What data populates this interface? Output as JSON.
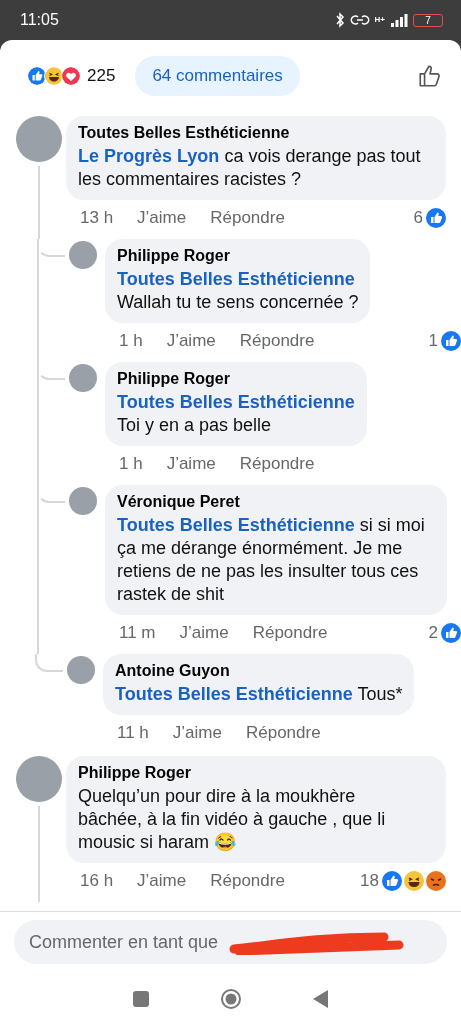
{
  "status_bar": {
    "time": "11:05",
    "network_type": "H+",
    "battery": "7"
  },
  "header": {
    "reactions": [
      {
        "kind": "like"
      },
      {
        "kind": "haha"
      },
      {
        "kind": "love"
      }
    ],
    "reaction_count": "225",
    "comments_button": "64 commentaires"
  },
  "comments": [
    {
      "author": "Toutes Belles Esthéticienne",
      "mention": "Le Progrès Lyon",
      "text": " ca vois derange pas tout les commentaires racistes ?",
      "time": "13 h",
      "like": "J’aime",
      "reply": "Répondre",
      "count": "6",
      "reactions": [
        {
          "kind": "like"
        }
      ],
      "children": [
        {
          "author": "Philippe Roger",
          "mention": "Toutes Belles Esthéticienne",
          "text": "\nWallah tu te sens concernée ?",
          "time": "1 h",
          "like": "J’aime",
          "reply": "Répondre",
          "count": "1",
          "reactions": [
            {
              "kind": "like"
            }
          ]
        },
        {
          "author": "Philippe Roger",
          "mention": "Toutes Belles Esthéticienne",
          "text": "\nToi y en a pas belle",
          "time": "1 h",
          "like": "J’aime",
          "reply": "Répondre"
        },
        {
          "author": "Véronique Peret",
          "mention": "Toutes Belles Esthéticienne",
          "text": " si si moi ça me dérange énormément. Je me retiens de ne pas les insulter tous ces rastek de shit",
          "time": "11 m",
          "like": "J’aime",
          "reply": "Répondre",
          "count": "2",
          "reactions": [
            {
              "kind": "like"
            }
          ]
        },
        {
          "author": "Antoine Guyon",
          "mention": "Toutes Belles Esthéticienne",
          "text": " Tous*",
          "time": "11 h",
          "like": "J’aime",
          "reply": "Répondre"
        }
      ]
    },
    {
      "author": "Philippe Roger",
      "text": "Quelqu’un pour dire à la moukhère\nbâchée, à la fin vidéo à gauche , que li mousic si haram 😂",
      "time": "16 h",
      "like": "J’aime",
      "reply": "Répondre",
      "count": "18",
      "reactions": [
        {
          "kind": "like"
        },
        {
          "kind": "haha"
        },
        {
          "kind": "angry"
        }
      ]
    }
  ],
  "comment_field": {
    "placeholder": "Commenter en tant que"
  }
}
